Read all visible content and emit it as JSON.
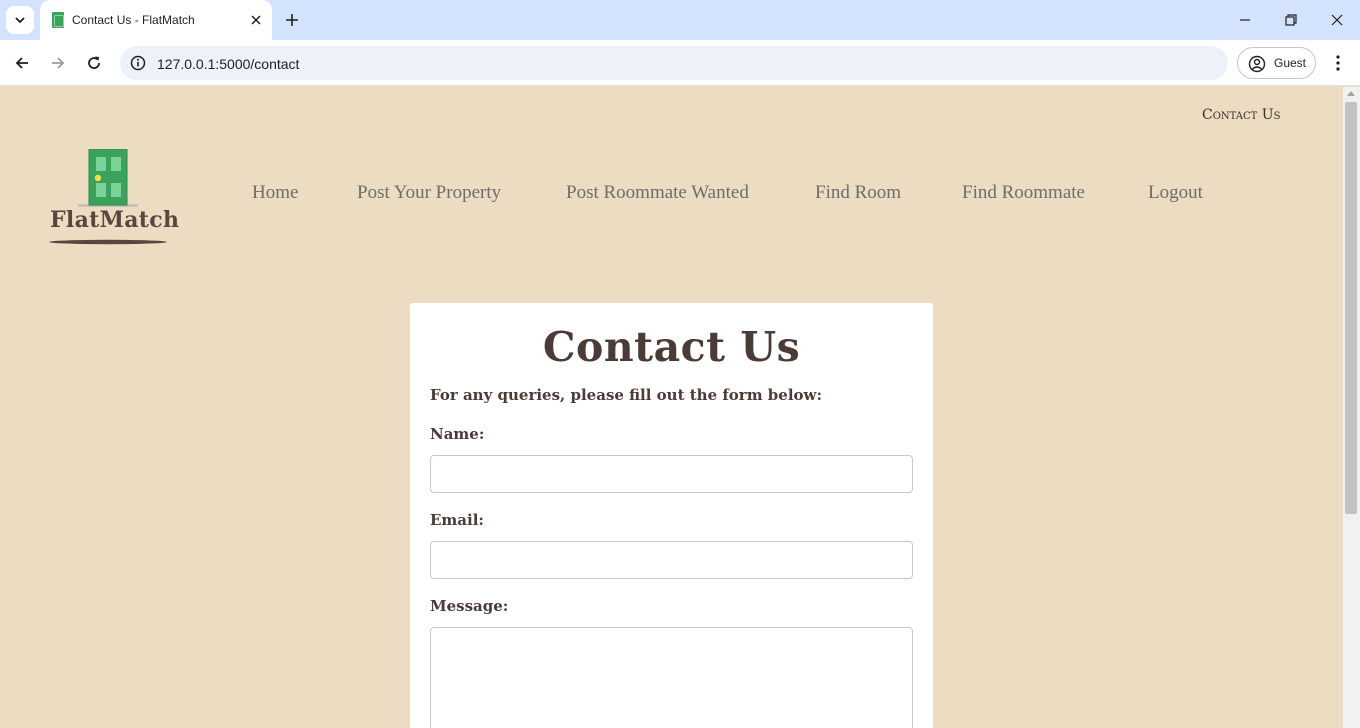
{
  "browser": {
    "tab_title": "Contact Us - FlatMatch",
    "url": "127.0.0.1:5000/contact",
    "profile_label": "Guest"
  },
  "site": {
    "top_link": "Contact Us",
    "logo_text": "FlatMatch",
    "nav": [
      "Home",
      "Post Your Property",
      "Post Roommate Wanted",
      "Find Room",
      "Find Roommate",
      "Logout"
    ]
  },
  "contact": {
    "title": "Contact Us",
    "intro": "For any queries, please fill out the form below:",
    "name_label": "Name:",
    "name_value": "",
    "email_label": "Email:",
    "email_value": "",
    "message_label": "Message:",
    "message_value": ""
  },
  "colors": {
    "page_bg": "#ecdcc2",
    "text_dark": "#4b3b37",
    "nav_text": "#6d6d6d",
    "door_green": "#3aa25a"
  }
}
